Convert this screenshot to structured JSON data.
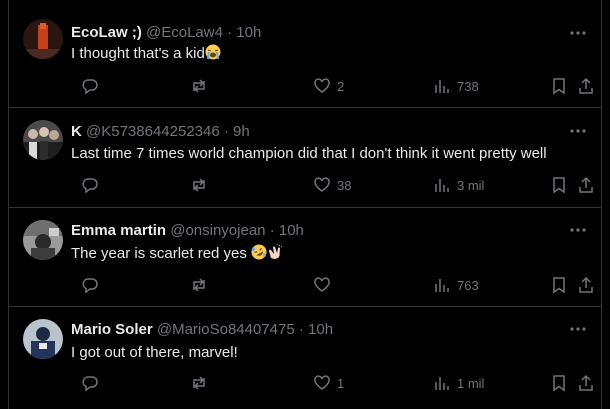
{
  "tweets": [
    {
      "name": "EcoLaw ;)",
      "handle": "@EcoLaw4",
      "time": "10h",
      "text": "I thought that's a kid",
      "emoji": [
        "loudly-crying-face"
      ],
      "likes": "2",
      "views": "738"
    },
    {
      "name": "K",
      "handle": "@K5738644252346",
      "time": "9h",
      "text": "Last time 7 times world champion did that I don't think it went pretty well",
      "emoji": [],
      "likes": "38",
      "views": "3 mil"
    },
    {
      "name": "Emma martin",
      "handle": "@onsinyojean",
      "time": "10h",
      "text": "The year is scarlet red yes",
      "emoji": [
        "rolling-on-floor-laughing",
        "clapping-hands"
      ],
      "likes": "",
      "views": "763"
    },
    {
      "name": "Mario Soler",
      "handle": "@MarioSo84407475",
      "time": "10h",
      "text": "I got out of there, marvel!",
      "emoji": [],
      "likes": "1",
      "views": "1 mil"
    }
  ],
  "separator": "·",
  "colors": {
    "background": "#000000",
    "text": "#e7e9ea",
    "muted": "#71767b",
    "divider": "#2f3336"
  },
  "icons": [
    "more-icon",
    "reply-icon",
    "repost-icon",
    "like-icon",
    "views-icon",
    "bookmark-icon",
    "share-icon"
  ]
}
